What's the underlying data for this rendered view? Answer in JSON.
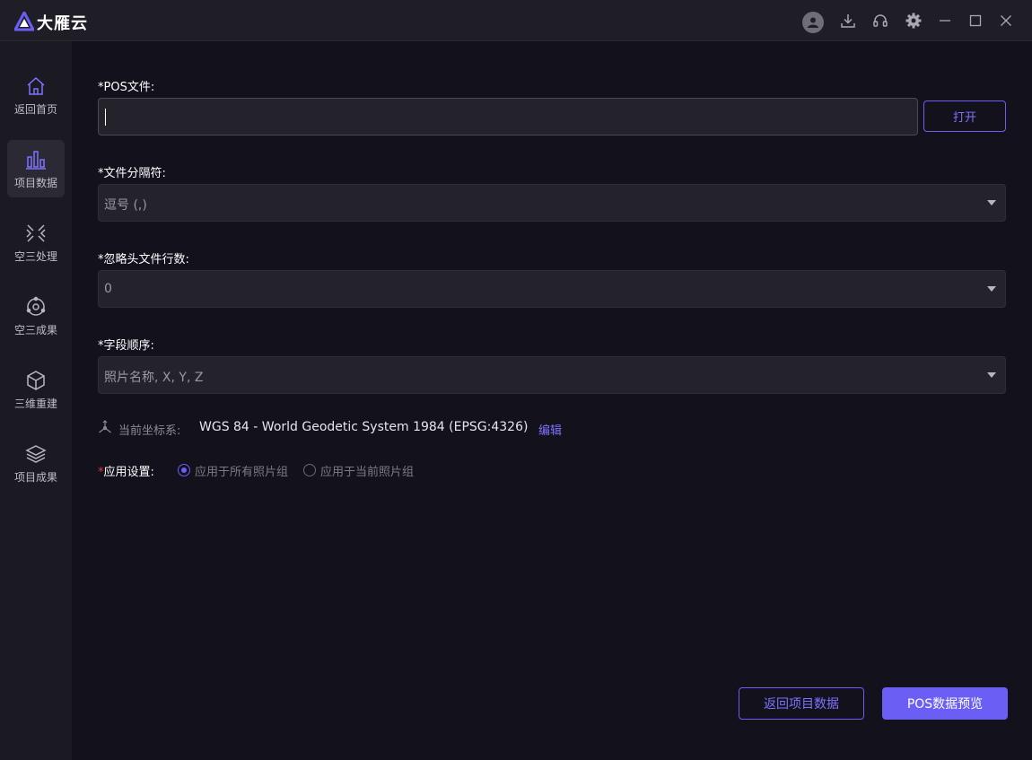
{
  "app": {
    "title": "大雁云",
    "brand_color": "#6b5ef5"
  },
  "titlebar": {
    "icons": [
      "user-avatar-icon",
      "download-icon",
      "headset-icon",
      "gear-icon",
      "minimize-icon",
      "maximize-icon",
      "close-icon"
    ]
  },
  "sidebar": {
    "items": [
      {
        "label": "返回首页",
        "icon": "home-icon"
      },
      {
        "label": "项目数据",
        "icon": "bar-chart-icon",
        "active": true
      },
      {
        "label": "空三处理",
        "icon": "aerial-process-icon"
      },
      {
        "label": "空三成果",
        "icon": "aerial-result-icon"
      },
      {
        "label": "三维重建",
        "icon": "cube-icon"
      },
      {
        "label": "项目成果",
        "icon": "layers-icon"
      }
    ]
  },
  "form": {
    "pos_file": {
      "label": "*POS文件:",
      "value": "",
      "open_button": "打开"
    },
    "delimiter": {
      "label": "*文件分隔符:",
      "value": "逗号 (,)"
    },
    "skip_rows": {
      "label": "*忽略头文件行数:",
      "value": "0"
    },
    "field_order": {
      "label": "*字段顺序:",
      "value": "照片名称, X, Y, Z"
    },
    "crs": {
      "label": "当前坐标系:",
      "value": "WGS 84 - World Geodetic System 1984 (EPSG:4326)",
      "edit": "编辑"
    },
    "apply": {
      "required_mark": "*",
      "label": "应用设置:",
      "options": [
        {
          "label": "应用于所有照片组",
          "checked": true
        },
        {
          "label": "应用于当前照片组",
          "checked": false
        }
      ]
    }
  },
  "footer": {
    "back_button": "返回项目数据",
    "preview_button": "POS数据预览"
  }
}
